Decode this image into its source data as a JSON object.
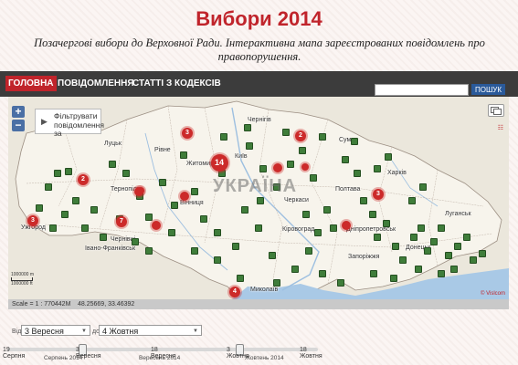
{
  "page": {
    "title": "Вибори 2014",
    "subtitle": "Позачергові вибори до Верховної Ради. Інтерактивна мапа зареєстрованих повідомлень про правопорушення."
  },
  "nav": {
    "items": [
      {
        "label": "ГОЛОВНА",
        "active": true
      },
      {
        "label": "ПОВІДОМЛЕННЯ",
        "active": false
      },
      {
        "label": "СТАТТІ З КОДЕКСІВ",
        "active": false
      }
    ],
    "search_value": "",
    "search_button": "ПОШУК"
  },
  "map": {
    "zoom_in": "+",
    "zoom_out": "−",
    "filter_label": "Фільтрувати повідомлення за",
    "country_label": "УКРАЇНА",
    "credit": "© Vislcom",
    "scale_top": "1000000 m",
    "scale_bottom": "1000000 ft",
    "cities": [
      {
        "name": "Чернігів"
      },
      {
        "name": "Суми"
      },
      {
        "name": "Луцьк"
      },
      {
        "name": "Рівне"
      },
      {
        "name": "Житомир"
      },
      {
        "name": "Київ"
      },
      {
        "name": "Харків"
      },
      {
        "name": "Тернопіль"
      },
      {
        "name": "Вінниця"
      },
      {
        "name": "Полтава"
      },
      {
        "name": "Ужгород"
      },
      {
        "name": "Івано-Франківськ"
      },
      {
        "name": "Черкаси"
      },
      {
        "name": "Чернівці"
      },
      {
        "name": "Кіровоград"
      },
      {
        "name": "Дніпропетровськ"
      },
      {
        "name": "Луганськ"
      },
      {
        "name": "Донецьк"
      },
      {
        "name": "Запоріжжя"
      },
      {
        "name": "Миколаїв"
      }
    ],
    "clusters": [
      {
        "count": "3"
      },
      {
        "count": "2"
      },
      {
        "count": "14"
      },
      {
        "count": "2"
      },
      {
        "count": "3"
      },
      {
        "count": "7"
      },
      {
        "count": "3"
      },
      {
        "count": "4"
      },
      {
        "count": ""
      },
      {
        "count": ""
      },
      {
        "count": ""
      },
      {
        "count": ""
      },
      {
        "count": ""
      },
      {
        "count": ""
      },
      {
        "count": ""
      }
    ]
  },
  "status": {
    "scale": "Scale = 1 : 770442M",
    "coords": "48.25669, 33.46392"
  },
  "range": {
    "from_label": "Від",
    "from_value": "3 Вересня",
    "to_label": "до",
    "to_value": "4 Жовтня"
  },
  "timeline": {
    "ticks": [
      {
        "day": "19",
        "month": "Серпня"
      },
      {
        "day": "3",
        "month": "Вересня"
      },
      {
        "day": "18",
        "month": "Вересня"
      },
      {
        "day": "3",
        "month": "Жовтня"
      },
      {
        "day": "18",
        "month": "Жовтня"
      }
    ],
    "months": [
      "Серпень 2014",
      "Вересень 2014",
      "Жовтень 2014"
    ]
  },
  "colors": {
    "brand_red": "#c0242b",
    "cluster_red": "#cc2a2a",
    "marker_green": "#3f7d3a",
    "navbar": "#3c3c3c"
  }
}
